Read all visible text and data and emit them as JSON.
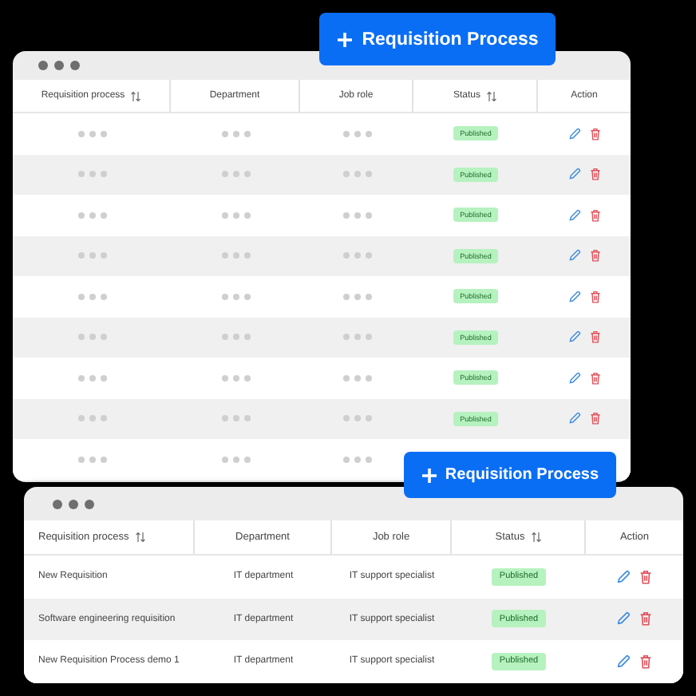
{
  "windows": [
    {
      "kind": "back",
      "button": {
        "label": "Requisition Process"
      },
      "columns": [
        {
          "label": "Requisition process",
          "sortable": true
        },
        {
          "label": "Department",
          "sortable": false
        },
        {
          "label": "Job role",
          "sortable": false
        },
        {
          "label": "Status",
          "sortable": true
        },
        {
          "label": "Action",
          "sortable": false
        }
      ],
      "rows": [
        {
          "kind": "placeholder",
          "status": "Published"
        },
        {
          "kind": "placeholder",
          "status": "Published"
        },
        {
          "kind": "placeholder",
          "status": "Published"
        },
        {
          "kind": "placeholder",
          "status": "Published"
        },
        {
          "kind": "placeholder",
          "status": "Published"
        },
        {
          "kind": "placeholder",
          "status": "Published"
        },
        {
          "kind": "placeholder",
          "status": "Published"
        },
        {
          "kind": "placeholder",
          "status": "Published"
        },
        {
          "kind": "placeholder"
        }
      ]
    },
    {
      "kind": "front",
      "button": {
        "label": "Requisition Process"
      },
      "columns": [
        {
          "label": "Requisition process",
          "sortable": true
        },
        {
          "label": "Department",
          "sortable": false
        },
        {
          "label": "Job role",
          "sortable": false
        },
        {
          "label": "Status",
          "sortable": true
        },
        {
          "label": "Action",
          "sortable": false
        }
      ],
      "rows": [
        {
          "kind": "data",
          "cells": [
            "New Requisition",
            "IT department",
            "IT support specialist"
          ],
          "status": "Published"
        },
        {
          "kind": "data",
          "cells": [
            "Software engineering requisition",
            "IT department",
            "IT support specialist"
          ],
          "status": "Published"
        },
        {
          "kind": "data",
          "cells": [
            "New Requisition Process demo 1",
            "IT department",
            "IT support specialist"
          ],
          "status": "Published"
        }
      ]
    }
  ]
}
